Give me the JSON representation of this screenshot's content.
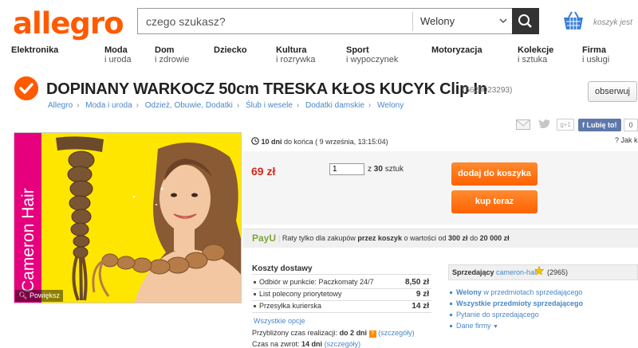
{
  "header": {
    "logo": "allegro",
    "search_placeholder": "czego szukasz?",
    "search_category": "Welony",
    "basket_label": "koszyk jest"
  },
  "nav": [
    {
      "main": "Elektronika",
      "sub": ""
    },
    {
      "main": "Moda",
      "sub": "i uroda"
    },
    {
      "main": "Dom",
      "sub": "i zdrowie"
    },
    {
      "main": "Dziecko",
      "sub": ""
    },
    {
      "main": "Kultura",
      "sub": "i rozrywka"
    },
    {
      "main": "Sport",
      "sub": "i wypoczynek"
    },
    {
      "main": "Motoryzacja",
      "sub": ""
    },
    {
      "main": "Kolekcje",
      "sub": "i sztuka"
    },
    {
      "main": "Firma",
      "sub": "i usługi"
    }
  ],
  "product": {
    "title": "DOPINANY WARKOCZ 50cm TRESKA KŁOS KUCYK Clip In",
    "offer_id": "(5629023293)",
    "watch_label": "obserwuj",
    "breadcrumbs": [
      "Allegro",
      "Moda i uroda",
      "Odzież, Obuwie, Dodatki",
      "Ślub i wesele",
      "Dodatki damskie",
      "Welony"
    ],
    "brand_vertical": "Cameron Hair",
    "enlarge_label": "Powiększ"
  },
  "social": {
    "gplus": "g+1",
    "like_label": "Lubię to!",
    "like_count": "0",
    "jak_label": "Jak k"
  },
  "timing": {
    "days": "10 dni",
    "ends_label": "do końca",
    "end_date": "( 9 września, 13:15:04)"
  },
  "buy": {
    "price": "69 zł",
    "quantity": "1",
    "of_label": "z",
    "stock": "30",
    "unit": "sztuk",
    "add_to_cart": "dodaj do koszyka",
    "buy_now": "kup teraz"
  },
  "payu": {
    "logo": "PayU",
    "text_1": "Raty tylko dla zakupów",
    "text_2": "przez koszyk",
    "text_3": "o wartości od",
    "min": "300 zł",
    "text_4": "do",
    "max": "20 000 zł"
  },
  "shipping": {
    "title": "Koszty dostawy",
    "options": [
      {
        "name": "Odbiór w punkcie: Paczkomaty 24/7",
        "price": "8,50 zł"
      },
      {
        "name": "List polecony priorytetowy",
        "price": "9 zł"
      },
      {
        "name": "Przesyłka kurierska",
        "price": "14 zł"
      }
    ],
    "all_options": "Wszystkie opcje",
    "realization_label": "Przybliżony czas realizacji:",
    "realization_value": "do 2 dni",
    "details": "(szczegóły)",
    "return_label": "Czas na zwrot:",
    "return_value": "14 dni"
  },
  "seller": {
    "label": "Sprzedający",
    "name": "cameron-hair",
    "count": "(2965)",
    "links": [
      {
        "bold": "Welony",
        "rest": " w przedmiotach sprzedającego"
      },
      {
        "bold": "Wszystkie przedmioty sprzedającego",
        "rest": ""
      },
      {
        "bold": "",
        "rest": "Pytanie do sprzedającego"
      },
      {
        "bold": "",
        "rest": "Dane firmy"
      }
    ]
  },
  "colors": {
    "accent": "#ff5a00",
    "price": "#d4291b",
    "link": "#4a87c8",
    "image_bg": "#ffe600"
  }
}
